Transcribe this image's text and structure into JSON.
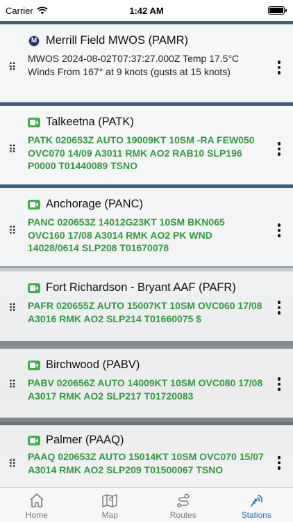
{
  "status": {
    "carrier": "Carrier",
    "time": "1:42 AM",
    "battery_level": 1.0
  },
  "stations": [
    {
      "name": "Merrill Field MWOS (PAMR)",
      "icon": "mwos-icon",
      "icon_letter": "M",
      "report_style": "plain",
      "report": "MWOS 2024-08-02T07:37:27.000Z Temp 17.5°C Winds From 167° at 9 knots (gusts at 15 knots)"
    },
    {
      "name": "Talkeetna (PATK)",
      "icon": "camera-icon",
      "report_style": "metar",
      "report": "PATK 020653Z AUTO 19009KT 10SM -RA FEW050 OVC070 14/09 A3011 RMK AO2 RAB10 SLP196 P0000 T01440089 TSNO"
    },
    {
      "name": "Anchorage (PANC)",
      "icon": "camera-icon",
      "report_style": "metar",
      "report": "PANC 020653Z 14012G23KT 10SM BKN065 OVC160 17/08 A3014 RMK AO2 PK WND 14028/0614 SLP208 T01670078"
    },
    {
      "name": "Fort Richardson - Bryant AAF (PAFR)",
      "icon": "camera-icon",
      "report_style": "metar",
      "report": "PAFR 020655Z AUTO 15007KT 10SM OVC060 17/08 A3016 RMK AO2 SLP214 T01660075 $"
    },
    {
      "name": "Birchwood (PABV)",
      "icon": "camera-icon",
      "report_style": "metar",
      "report": "PABV 020656Z AUTO 14009KT 10SM OVC080 17/08 A3017 RMK AO2 SLP217 T01720083"
    },
    {
      "name": "Palmer (PAAQ)",
      "icon": "camera-icon",
      "report_style": "metar",
      "report": "PAAQ 020653Z AUTO 15014KT 10SM OVC070 15/07 A3014 RMK AO2 SLP209 T01500067 TSNO"
    }
  ],
  "tabs": [
    {
      "label": "Home",
      "icon": "home-icon",
      "active": false
    },
    {
      "label": "Map",
      "icon": "map-icon",
      "active": false
    },
    {
      "label": "Routes",
      "icon": "routes-icon",
      "active": false
    },
    {
      "label": "Stations",
      "icon": "stations-icon",
      "active": true
    }
  ],
  "colors": {
    "metar_text": "#2f9a3c",
    "active_tab": "#1f74c9",
    "inactive_tab": "#7c7c7c",
    "card_border": "#3f5f7e"
  }
}
